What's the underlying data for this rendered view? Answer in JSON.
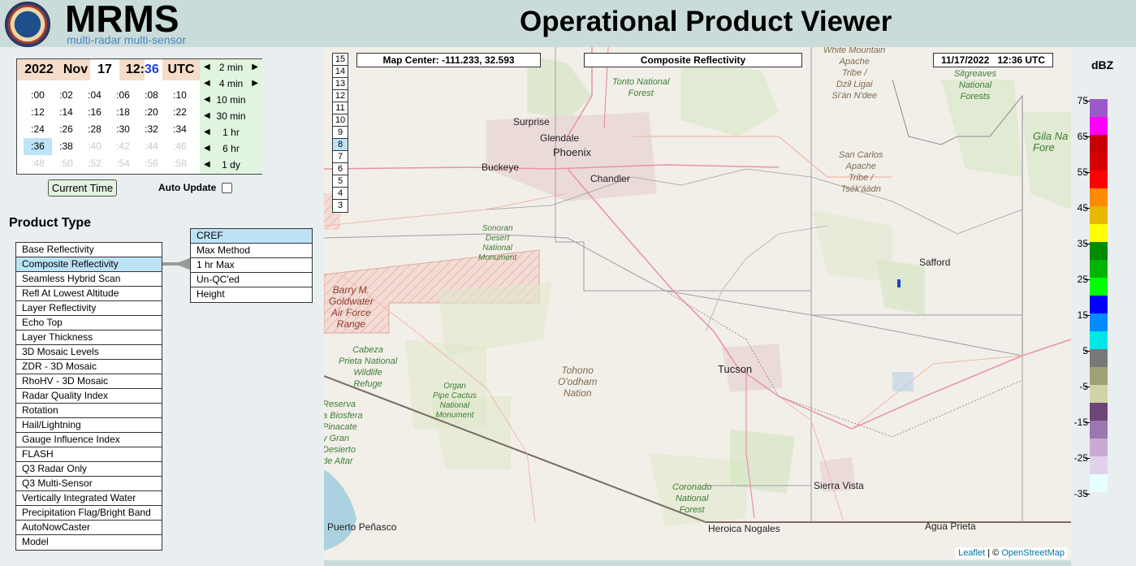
{
  "header": {
    "brand": "MRMS",
    "brand_sub": "multi-radar multi-sensor",
    "title": "Operational Product Viewer"
  },
  "time": {
    "year": "2022",
    "month": "Nov",
    "day": "17",
    "hour": "12:",
    "minute": "36",
    "tz": "UTC",
    "minutes": [
      {
        "label": ":00",
        "state": "active"
      },
      {
        "label": ":02",
        "state": "active"
      },
      {
        "label": ":04",
        "state": "active"
      },
      {
        "label": ":06",
        "state": "active"
      },
      {
        "label": ":08",
        "state": "active"
      },
      {
        "label": ":10",
        "state": "active"
      },
      {
        "label": ":12",
        "state": "active"
      },
      {
        "label": ":14",
        "state": "active"
      },
      {
        "label": ":16",
        "state": "active"
      },
      {
        "label": ":18",
        "state": "active"
      },
      {
        "label": ":20",
        "state": "active"
      },
      {
        "label": ":22",
        "state": "active"
      },
      {
        "label": ":24",
        "state": "active"
      },
      {
        "label": ":26",
        "state": "active"
      },
      {
        "label": ":28",
        "state": "active"
      },
      {
        "label": ":30",
        "state": "active"
      },
      {
        "label": ":32",
        "state": "active"
      },
      {
        "label": ":34",
        "state": "active"
      },
      {
        "label": ":36",
        "state": "selected"
      },
      {
        "label": ":38",
        "state": "active"
      },
      {
        "label": ":40",
        "state": "disabled"
      },
      {
        "label": ":42",
        "state": "disabled"
      },
      {
        "label": ":44",
        "state": "disabled"
      },
      {
        "label": ":46",
        "state": "disabled"
      },
      {
        "label": ":48",
        "state": "disabled"
      },
      {
        "label": ":50",
        "state": "disabled"
      },
      {
        "label": ":52",
        "state": "disabled"
      },
      {
        "label": ":54",
        "state": "disabled"
      },
      {
        "label": ":56",
        "state": "disabled"
      },
      {
        "label": ":58",
        "state": "disabled"
      }
    ],
    "steps": [
      {
        "label": "2 min",
        "right_arrow": true
      },
      {
        "label": "4 min",
        "right_arrow": true
      },
      {
        "label": "10 min",
        "right_arrow": false
      },
      {
        "label": "30 min",
        "right_arrow": false
      },
      {
        "label": "1 hr",
        "right_arrow": false
      },
      {
        "label": "6 hr",
        "right_arrow": false
      },
      {
        "label": "1 dy",
        "right_arrow": false
      }
    ],
    "current_time_label": "Current Time",
    "auto_update_label": "Auto Update"
  },
  "product": {
    "heading": "Product Type",
    "items": [
      "Base Reflectivity",
      "Composite Reflectivity",
      "Seamless Hybrid Scan",
      "Refl At Lowest Altitude",
      "Layer Reflectivity",
      "Echo Top",
      "Layer Thickness",
      "3D Mosaic Levels",
      "ZDR - 3D Mosaic",
      "RhoHV - 3D Mosaic",
      "Radar Quality Index",
      "Rotation",
      "Hail/Lightning",
      "Gauge Influence Index",
      "FLASH",
      "Q3 Radar Only",
      "Q3 Multi-Sensor",
      "Vertically Integrated Water",
      "Precipitation Flag/Bright Band",
      "AutoNowCaster",
      "Model"
    ],
    "selected": "Composite Reflectivity",
    "sub_items": [
      "CREF",
      "Max Method",
      "1 hr Max",
      "Un-QC'ed",
      "Height"
    ],
    "sub_selected": "CREF"
  },
  "map": {
    "zoom_levels": [
      "15",
      "14",
      "13",
      "12",
      "11",
      "10",
      "9",
      "8",
      "7",
      "6",
      "5",
      "4",
      "3"
    ],
    "zoom_selected": "8",
    "center_label": "Map Center: -111.233, 32.593",
    "product_label": "Composite Reflectivity",
    "datetime_label": "11/17/2022   12:36 UTC",
    "attribution_leaflet": "Leaflet",
    "attribution_sep": " | © ",
    "attribution_osm": "OpenStreetMap",
    "cities": {
      "surprise": "Surprise",
      "glendale": "Glendale",
      "phoenix": "Phoenix",
      "chandler": "Chandler",
      "buckeye": "Buckeye",
      "tucson": "Tucson",
      "safford": "Safford",
      "sierra_vista": "Sierra Vista",
      "puerto_penasco": "Puerto Peñasco",
      "heroica_nogales": "Heroica Nogales",
      "agua_prieta": "Agua Prieta"
    },
    "areas": {
      "tonto": "Tonto National\nForest",
      "white_mountain": "White Mountain\nApache\nTribe /\nDził Ligai\nSi'án N'dee",
      "sitgreaves": "Sitgreaves\nNational\nForests",
      "gila": "Gila Na\nFore",
      "san_carlos": "San Carlos\nApache\nTribe /\nTsék'áádn",
      "sonoran": "Sonoran\nDesert\nNational\nMonument",
      "barry": "Barry M.\nGoldwater\nAir Force\nRange",
      "cabeza": "Cabeza\nPrieta National\nWildlife\nRefuge",
      "tohono": "Tohono\nO'odham\nNation",
      "organ": "Organ\nPipe Cactus\nNational\nMonument",
      "reserva": "Reserva\na Biosfera\nPinacate\ny Gran\nDesierto\nde Altar",
      "coronado": "Coronado\nNational\nForest"
    }
  },
  "legend": {
    "title": "dBZ",
    "labels": [
      "75",
      "65",
      "55",
      "45",
      "35",
      "25",
      "15",
      "5",
      "-5",
      "-15",
      "-25",
      "-35"
    ],
    "colors": [
      "#9c59c9",
      "#ff00ff",
      "#c80000",
      "#d70000",
      "#ff0000",
      "#ff8c00",
      "#e6b800",
      "#ffff00",
      "#008c00",
      "#00b400",
      "#00ff00",
      "#0000ff",
      "#008cff",
      "#00e6e6",
      "#787878",
      "#a0a078",
      "#d2d2aa",
      "#6e4678",
      "#9b78af",
      "#c8aad2",
      "#e1d2eb",
      "#e6ffff"
    ]
  }
}
